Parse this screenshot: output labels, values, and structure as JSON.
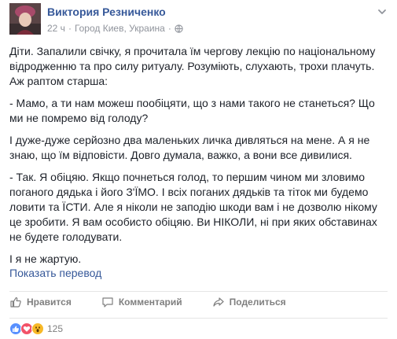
{
  "post": {
    "author": "Виктория Резниченко",
    "time": "22 ч",
    "separator": "·",
    "location": "Город Киев, Украина",
    "paragraphs": [
      "Діти. Запалили свічку, я прочитала їм чергову лекцію по національному\nвідродженню та про силу ритуалу. Розуміють, слухають, трохи плачуть.\nАж раптом старша:",
      "- Мамо, а ти нам можеш пообіцяти, що з нами такого не станеться? Що\nми не помремо від голоду?",
      "І дуже-дуже серйозно два маленьких личка дивляться на мене. А я не\nзнаю, що їм відповісти. Довго думала, важко, а вони все дивилися.",
      "- Так. Я обіцяю. Якщо почнеться голод, то першим чином ми зловимо\nпоганого дядька і його З'ЇМО. І всіх поганих дядьків та тіток ми будемо\nловити та ЇСТИ. Але я ніколи не заподію шкоди вам і не дозволю нікому\nце зробити. Я вам особисто обіцяю. Ви НІКОЛИ, ні при яких обставинах\nне будете голодувати.",
      "І я не жартую."
    ],
    "translate_link": "Показать перевод"
  },
  "actions": {
    "like": "Нравится",
    "comment": "Комментарий",
    "share": "Поделиться"
  },
  "reactions": {
    "count": "125",
    "types": [
      "like-icon",
      "love-icon",
      "wow-icon"
    ]
  },
  "colors": {
    "link": "#365899",
    "text": "#1d2129",
    "muted": "#90949c",
    "like": "#5890ff",
    "love": "#f25268",
    "wow": "#f7b928"
  }
}
